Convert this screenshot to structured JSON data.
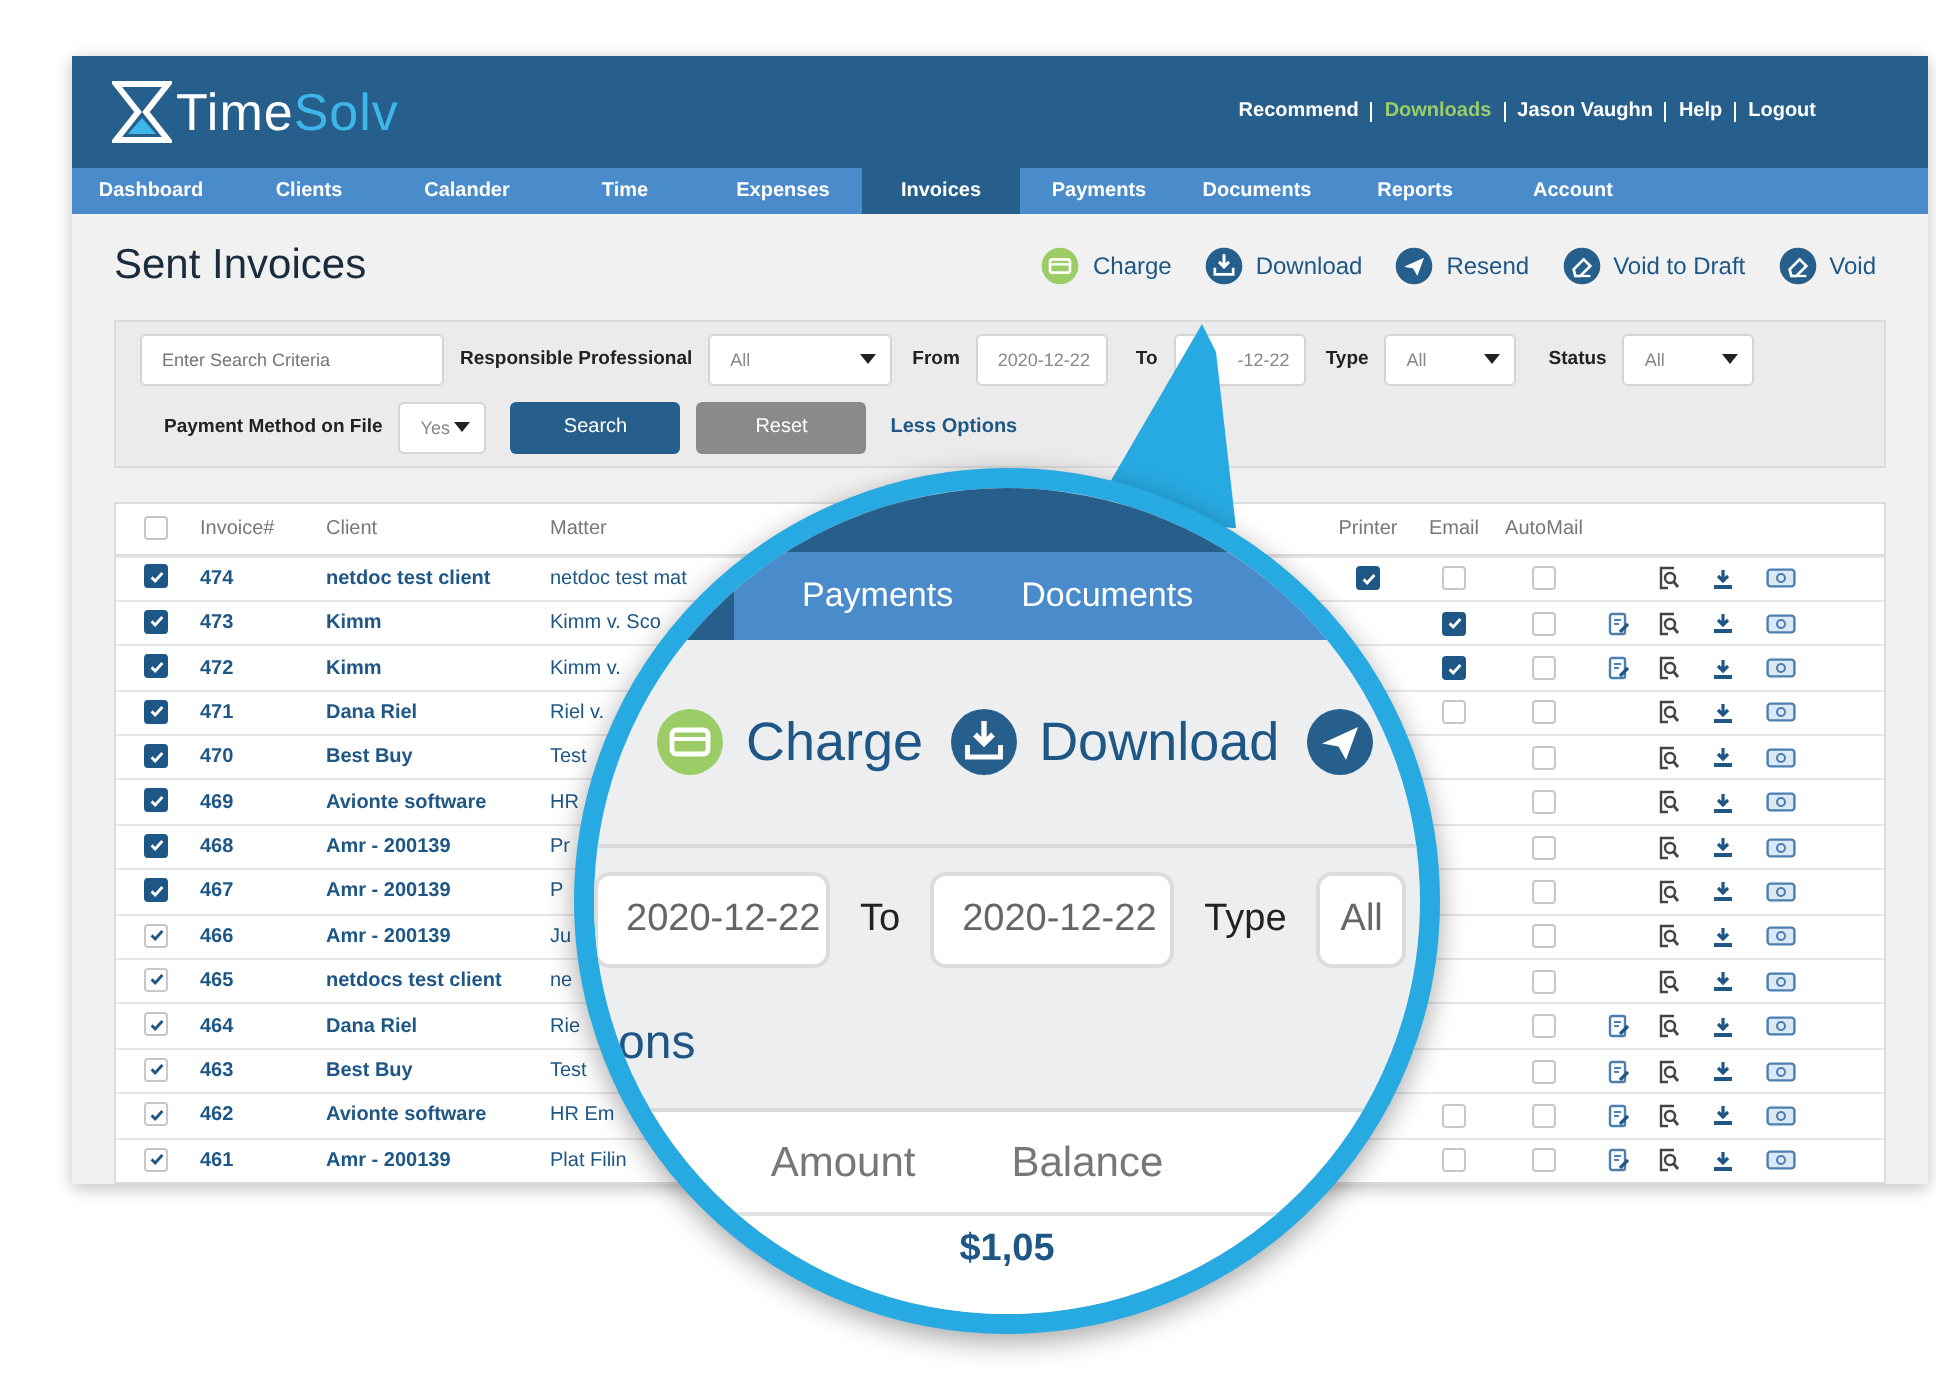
{
  "header": {
    "logo_first": "Time",
    "logo_second": "Solv",
    "links": [
      {
        "label": "Recommend",
        "highlighted": false
      },
      {
        "label": "Downloads",
        "highlighted": true
      },
      {
        "label": "Jason Vaughn",
        "highlighted": false
      },
      {
        "label": "Help",
        "highlighted": false
      },
      {
        "label": "Logout",
        "highlighted": false
      }
    ]
  },
  "nav": [
    {
      "label": "Dashboard",
      "selected": false
    },
    {
      "label": "Clients",
      "selected": false
    },
    {
      "label": "Calander",
      "selected": false
    },
    {
      "label": "Time",
      "selected": false
    },
    {
      "label": "Expenses",
      "selected": false
    },
    {
      "label": "Invoices",
      "selected": true
    },
    {
      "label": "Payments",
      "selected": false
    },
    {
      "label": "Documents",
      "selected": false
    },
    {
      "label": "Reports",
      "selected": false
    },
    {
      "label": "Account",
      "selected": false
    }
  ],
  "page_title": "Sent Invoices",
  "actions": [
    {
      "kind": "charge",
      "label": "Charge"
    },
    {
      "kind": "download",
      "label": "Download"
    },
    {
      "kind": "resend",
      "label": "Resend"
    },
    {
      "kind": "void",
      "label": "Void to Draft"
    },
    {
      "kind": "void",
      "label": "Void"
    }
  ],
  "filters": {
    "search": {
      "placeholder": "Enter Search Criteria"
    },
    "responsible_label": "Responsible Professional",
    "responsible_value": "All",
    "from_label": "From",
    "from_value": "2020-12-22",
    "to_label": "To",
    "to_value": "-12-22",
    "type_label": "Type",
    "type_value": "All",
    "status_label": "Status",
    "status_value": "All",
    "payment_label": "Payment Method on File",
    "payment_value": "Yes",
    "search_button": "Search",
    "reset_button": "Reset",
    "toggle_link": "Less Options"
  },
  "table": {
    "all_checked": false,
    "columns": [
      "Invoice#",
      "Client",
      "Matter",
      "Printer",
      "Email",
      "AutoMail"
    ],
    "rows": [
      {
        "kind": "solid",
        "checked": true,
        "invoice": "474",
        "client": "netdoc test client",
        "matter": "netdoc test mat",
        "printer": true,
        "email": false,
        "automail": false,
        "editable": false
      },
      {
        "kind": "solid",
        "checked": true,
        "invoice": "473",
        "client": "Kimm",
        "matter": "Kimm v. Sco",
        "email": true,
        "automail": false,
        "editable": true
      },
      {
        "kind": "solid",
        "checked": true,
        "invoice": "472",
        "client": "Kimm",
        "matter": "Kimm v.",
        "email": true,
        "automail": false,
        "editable": true
      },
      {
        "kind": "solid",
        "checked": true,
        "invoice": "471",
        "client": "Dana Riel",
        "matter": "Riel v.",
        "email": false,
        "automail": false,
        "editable": false
      },
      {
        "kind": "solid",
        "checked": true,
        "invoice": "470",
        "client": "Best Buy",
        "matter": "Test",
        "automail": false,
        "editable": false
      },
      {
        "kind": "solid",
        "checked": true,
        "invoice": "469",
        "client": "Avionte software",
        "matter": "HR",
        "automail": false,
        "editable": false
      },
      {
        "kind": "solid",
        "checked": true,
        "invoice": "468",
        "client": "Amr - 200139",
        "matter": "Pr",
        "automail": false,
        "editable": false
      },
      {
        "kind": "solid",
        "checked": true,
        "invoice": "467",
        "client": "Amr - 200139",
        "matter": "P",
        "automail": false,
        "editable": false
      },
      {
        "kind": "plain",
        "checked": true,
        "invoice": "466",
        "client": "Amr - 200139",
        "matter": "Ju",
        "automail": false,
        "editable": false
      },
      {
        "kind": "plain",
        "checked": true,
        "invoice": "465",
        "client": "netdocs test client",
        "matter": "ne",
        "automail": false,
        "editable": false
      },
      {
        "kind": "plain",
        "checked": true,
        "invoice": "464",
        "client": "Dana Riel",
        "matter": "Rie",
        "automail": false,
        "editable": true
      },
      {
        "kind": "plain",
        "checked": true,
        "invoice": "463",
        "client": "Best Buy",
        "matter": "Test",
        "automail": false,
        "editable": true
      },
      {
        "kind": "plain",
        "checked": true,
        "invoice": "462",
        "client": "Avionte software",
        "matter": "HR Em",
        "email": false,
        "automail": false,
        "editable": true
      },
      {
        "kind": "plain",
        "checked": true,
        "invoice": "461",
        "client": "Amr - 200139",
        "matter": "Plat Filin",
        "email": false,
        "automail": false,
        "editable": true
      }
    ]
  },
  "magnifier": {
    "nav": [
      {
        "label": "Payments"
      },
      {
        "label": "Documents"
      }
    ],
    "actions": [
      {
        "kind": "charge",
        "label": "Charge"
      },
      {
        "kind": "download",
        "label": "Download"
      },
      {
        "kind": "resend"
      }
    ],
    "from_value": "2020-12-22",
    "to_label": "To",
    "to_value": "2020-12-22",
    "type_label": "Type",
    "type_value": "All",
    "link_fragment": "ons",
    "columns": [
      "Amount",
      "Balance"
    ],
    "amount_fragment": "$1,05"
  }
}
